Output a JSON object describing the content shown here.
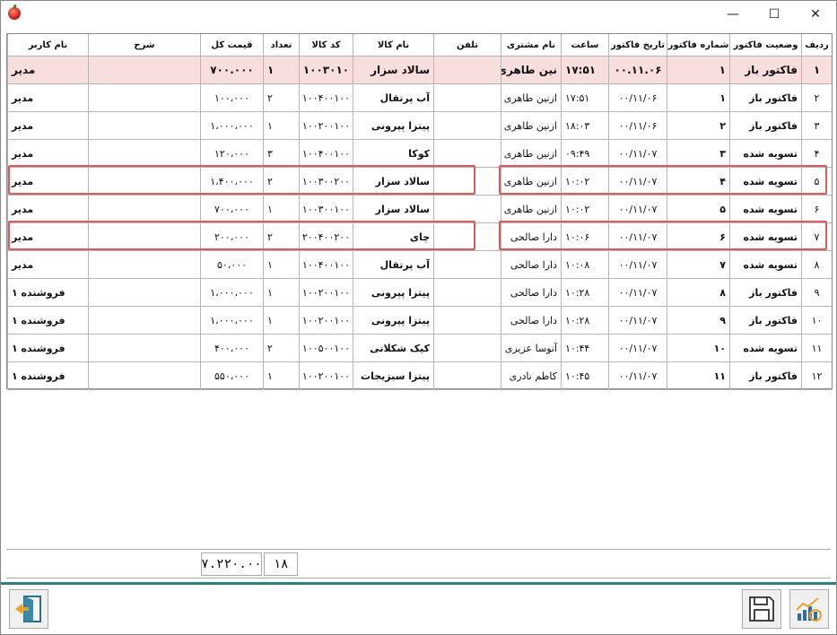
{
  "window": {
    "minimize": "—",
    "maximize": "☐",
    "close": "✕"
  },
  "columns": {
    "row_no": "ردیف",
    "status": "وضعیت فاکتور",
    "invoice_no": "شماره فاکتور",
    "date": "تاریخ فاکتور",
    "time": "ساعت",
    "customer": "نام مشتری",
    "phone": "تلفن",
    "product": "نام کالا",
    "code": "کد کالا",
    "qty": "تعداد",
    "total": "قیمت کل",
    "desc": "شرح",
    "user": "نام کاربر"
  },
  "rows": [
    {
      "row_no": "۱",
      "status": "فاکتور باز",
      "invoice_no": "۱",
      "date": "۰۰.۱۱.۰۶",
      "time": "۱۷:۵۱",
      "customer": "نین طاهری",
      "phone": "",
      "product": "سالاد سزار",
      "code": "۱۰۰۳۰۱۰",
      "qty": "۱",
      "total": "۷۰۰.۰۰۰",
      "desc": "",
      "user": "مدیر"
    },
    {
      "row_no": "۲",
      "status": "فاکتور باز",
      "invoice_no": "۱",
      "date": "۰۰/۱۱/۰۶",
      "time": "۱۷:۵۱",
      "customer": "ازنین طاهری",
      "phone": "",
      "product": "آب پرتقال",
      "code": "۱۰۰۴۰۰۱۰۰",
      "qty": "۲",
      "total": "۱۰۰،۰۰۰",
      "desc": "",
      "user": "مدیر"
    },
    {
      "row_no": "۳",
      "status": "فاکتور باز",
      "invoice_no": "۲",
      "date": "۰۰/۱۱/۰۶",
      "time": "۱۸:۰۳",
      "customer": "ازنین طاهری",
      "phone": "",
      "product": "پیتزا پپرونی",
      "code": "۱۰۰۲۰۰۱۰۰",
      "qty": "۱",
      "total": "۱،۰۰۰،۰۰۰",
      "desc": "",
      "user": "مدیر"
    },
    {
      "row_no": "۴",
      "status": "تسویه شده",
      "invoice_no": "۳",
      "date": "۰۰/۱۱/۰۷",
      "time": "۰۹:۴۹",
      "customer": "ازنین طاهری",
      "phone": "",
      "product": "کوکا",
      "code": "۱۰۰۴۰۰۱۰۰",
      "qty": "۳",
      "total": "۱۲۰،۰۰۰",
      "desc": "",
      "user": "مدیر"
    },
    {
      "row_no": "۵",
      "status": "تسویه شده",
      "invoice_no": "۴",
      "date": "۰۰/۱۱/۰۷",
      "time": "۱۰:۰۲",
      "customer": "ازنین طاهری",
      "phone": "",
      "product": "سالاد سزار",
      "code": "۱۰۰۳۰۰۲۰۰",
      "qty": "۲",
      "total": "۱،۴۰۰،۰۰۰",
      "desc": "",
      "user": "مدیر"
    },
    {
      "row_no": "۶",
      "status": "تسویه شده",
      "invoice_no": "۵",
      "date": "۰۰/۱۱/۰۷",
      "time": "۱۰:۰۲",
      "customer": "ازنین طاهری",
      "phone": "",
      "product": "سالاد سزار",
      "code": "۱۰۰۳۰۰۱۰۰",
      "qty": "۱",
      "total": "۷۰۰،۰۰۰",
      "desc": "",
      "user": "مدیر"
    },
    {
      "row_no": "۷",
      "status": "تسویه شده",
      "invoice_no": "۶",
      "date": "۰۰/۱۱/۰۷",
      "time": "۱۰:۰۶",
      "customer": "دارا صالحی",
      "phone": "",
      "product": "چای",
      "code": "۲۰۰۴۰۰۲۰۰",
      "qty": "۲",
      "total": "۲۰۰،۰۰۰",
      "desc": "",
      "user": "مدیر"
    },
    {
      "row_no": "۸",
      "status": "تسویه شده",
      "invoice_no": "۷",
      "date": "۰۰/۱۱/۰۷",
      "time": "۱۰:۰۸",
      "customer": "دارا صالحی",
      "phone": "",
      "product": "آب پرتقال",
      "code": "۱۰۰۴۰۰۱۰۰",
      "qty": "۱",
      "total": "۵۰،۰۰۰",
      "desc": "",
      "user": "مدیر"
    },
    {
      "row_no": "۹",
      "status": "فاکتور باز",
      "invoice_no": "۸",
      "date": "۰۰/۱۱/۰۷",
      "time": "۱۰:۲۸",
      "customer": "دارا صالحی",
      "phone": "",
      "product": "پیتزا پپرونی",
      "code": "۱۰۰۲۰۰۱۰۰",
      "qty": "۱",
      "total": "۱،۰۰۰،۰۰۰",
      "desc": "",
      "user": "فروشنده ۱"
    },
    {
      "row_no": "۱۰",
      "status": "فاکتور باز",
      "invoice_no": "۹",
      "date": "۰۰/۱۱/۰۷",
      "time": "۱۰:۲۸",
      "customer": "دارا صالحی",
      "phone": "",
      "product": "پیتزا پپرونی",
      "code": "۱۰۰۲۰۰۱۰۰",
      "qty": "۱",
      "total": "۱،۰۰۰،۰۰۰",
      "desc": "",
      "user": "فروشنده ۱"
    },
    {
      "row_no": "۱۱",
      "status": "تسویه شده",
      "invoice_no": "۱۰",
      "date": "۰۰/۱۱/۰۷",
      "time": "۱۰:۴۴",
      "customer": "آنوسا عزیزی",
      "phone": "",
      "product": "کیک شکلاتی",
      "code": "۱۰۰۵۰۰۱۰۰",
      "qty": "۲",
      "total": "۴۰۰،۰۰۰",
      "desc": "",
      "user": "فروشنده ۱"
    },
    {
      "row_no": "۱۲",
      "status": "فاکتور باز",
      "invoice_no": "۱۱",
      "date": "۰۰/۱۱/۰۷",
      "time": "۱۰:۴۵",
      "customer": "کاظم نادری",
      "phone": "",
      "product": "پیتزا سبزیجات",
      "code": "۱۰۰۲۰۰۱۰۰",
      "qty": "۱",
      "total": "۵۵۰،۰۰۰",
      "desc": "",
      "user": "فروشنده ۱"
    }
  ],
  "summary": {
    "qty_total": "۱۸",
    "price_total": "۷.۲۲۰.۰۰"
  },
  "toolbar": {
    "exit_icon": "exit-icon",
    "save_icon": "save-icon",
    "report_icon": "chart-icon"
  }
}
